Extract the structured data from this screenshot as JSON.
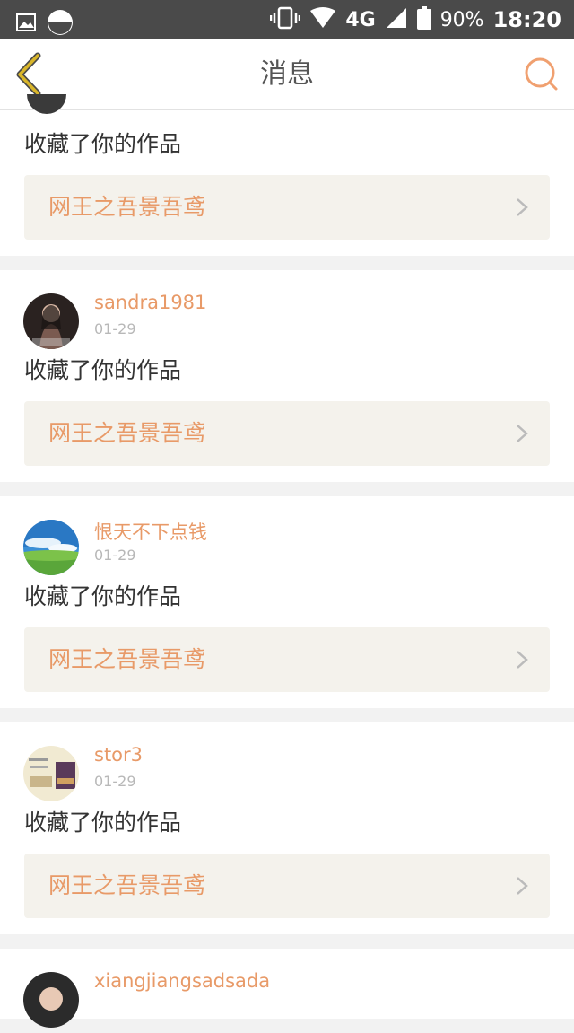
{
  "status_bar": {
    "network": "4G",
    "battery": "90%",
    "time": "18:20"
  },
  "header": {
    "title": "消息"
  },
  "notifications": [
    {
      "username": "",
      "date": "",
      "action": "收藏了你的作品",
      "work_title": "网王之吾景吾鸢"
    },
    {
      "username": "sandra1981",
      "date": "01-29",
      "action": "收藏了你的作品",
      "work_title": "网王之吾景吾鸢"
    },
    {
      "username": "恨天不下点钱",
      "date": "01-29",
      "action": "收藏了你的作品",
      "work_title": "网王之吾景吾鸢"
    },
    {
      "username": "stor3",
      "date": "01-29",
      "action": "收藏了你的作品",
      "work_title": "网王之吾景吾鸢"
    },
    {
      "username": "xiangjiangsadsada",
      "date": "",
      "action": "",
      "work_title": ""
    }
  ],
  "colors": {
    "accent": "#e89a68",
    "back_icon": "#d9b62a",
    "status_bar_bg": "#4a4a4a",
    "work_bg": "#f4f2ec"
  }
}
